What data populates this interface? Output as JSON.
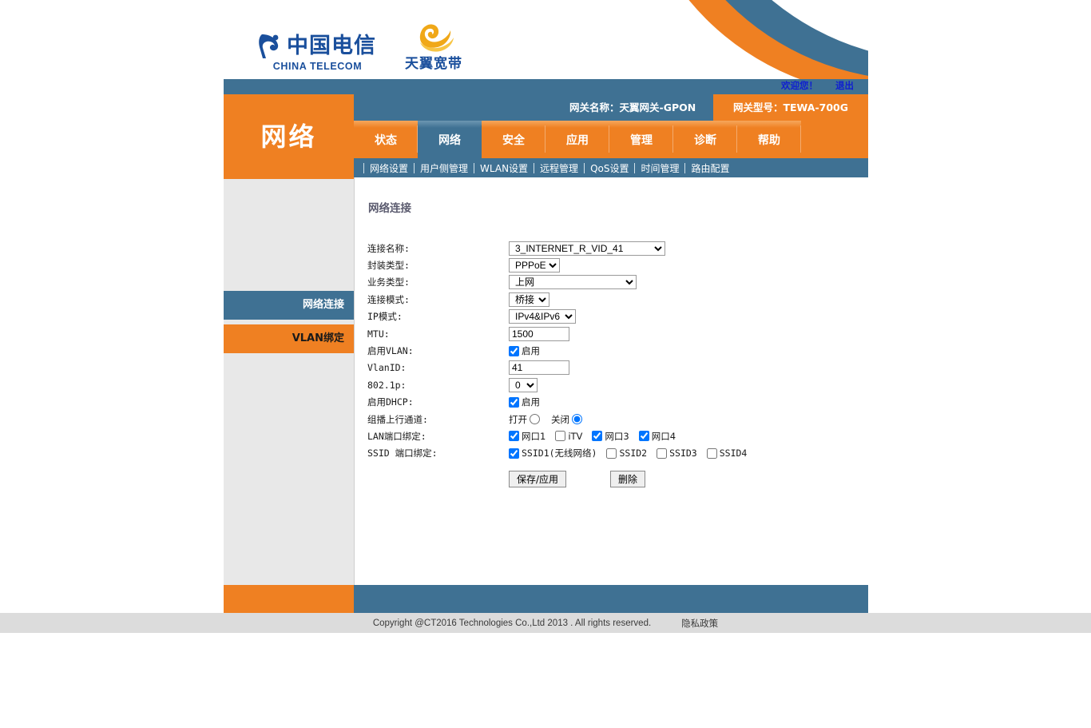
{
  "brand": {
    "china_telecom_cn": "中国电信",
    "china_telecom_en": "CHINA TELECOM",
    "tianyi_cn": "天翼宽带"
  },
  "header": {
    "welcome": "欢迎您！",
    "logout": "退出",
    "gateway_name": "网关名称：天翼网关-GPON",
    "gateway_model": "网关型号：TEWA-700G"
  },
  "tabs": [
    {
      "label": "状态",
      "active": false
    },
    {
      "label": "网络",
      "active": true
    },
    {
      "label": "安全",
      "active": false
    },
    {
      "label": "应用",
      "active": false
    },
    {
      "label": "管理",
      "active": false
    },
    {
      "label": "诊断",
      "active": false
    },
    {
      "label": "帮助",
      "active": false
    }
  ],
  "subnav": [
    "网络设置",
    "用户侧管理",
    "WLAN设置",
    "远程管理",
    "QoS设置",
    "时间管理",
    "路由配置"
  ],
  "sidebar": {
    "title": "网络",
    "items": [
      {
        "label": "网络连接",
        "active": true
      },
      {
        "label": "VLAN绑定",
        "active": false
      }
    ]
  },
  "content": {
    "title": "网络连接",
    "fields": {
      "conn_name_label": "连接名称:",
      "conn_name_value": "3_INTERNET_R_VID_41",
      "encap_label": "封装类型:",
      "encap_value": "PPPoE",
      "service_label": "业务类型:",
      "service_value": "上网",
      "conn_mode_label": "连接模式:",
      "conn_mode_value": "桥接",
      "ip_mode_label": "IP模式:",
      "ip_mode_value": "IPv4&IPv6",
      "mtu_label": "MTU:",
      "mtu_value": "1500",
      "vlan_enable_label": "启用VLAN:",
      "vlan_enable_text": "启用",
      "vlan_enable_checked": true,
      "vlanid_label": "VlanID:",
      "vlanid_value": "41",
      "dot1p_label": "802.1p:",
      "dot1p_value": "0",
      "dhcp_enable_label": "启用DHCP:",
      "dhcp_enable_text": "启用",
      "dhcp_enable_checked": true,
      "multicast_label": "组播上行通道:",
      "multicast_on": "打开",
      "multicast_off": "关闭",
      "multicast_selected": "关闭",
      "lan_bind_label": "LAN端口绑定:",
      "ssid_bind_label": "SSID 端口绑定:"
    },
    "lan_ports": [
      {
        "label": "网口1",
        "checked": true
      },
      {
        "label": "iTV",
        "checked": false
      },
      {
        "label": "网口3",
        "checked": true
      },
      {
        "label": "网口4",
        "checked": true
      }
    ],
    "ssid_ports": [
      {
        "label": "SSID1(无线网络)",
        "checked": true
      },
      {
        "label": "SSID2",
        "checked": false
      },
      {
        "label": "SSID3",
        "checked": false
      },
      {
        "label": "SSID4",
        "checked": false
      }
    ],
    "save_button": "保存/应用",
    "delete_button": "删除"
  },
  "footer": {
    "copyright": "Copyright @CT2016 Technologies Co.,Ltd 2013 . All rights reserved.",
    "privacy": "隐私政策"
  },
  "colors": {
    "orange": "#ef8022",
    "blue": "#3f7193",
    "link_blue": "#1020d0",
    "footer_grey": "#dcdcdc"
  }
}
